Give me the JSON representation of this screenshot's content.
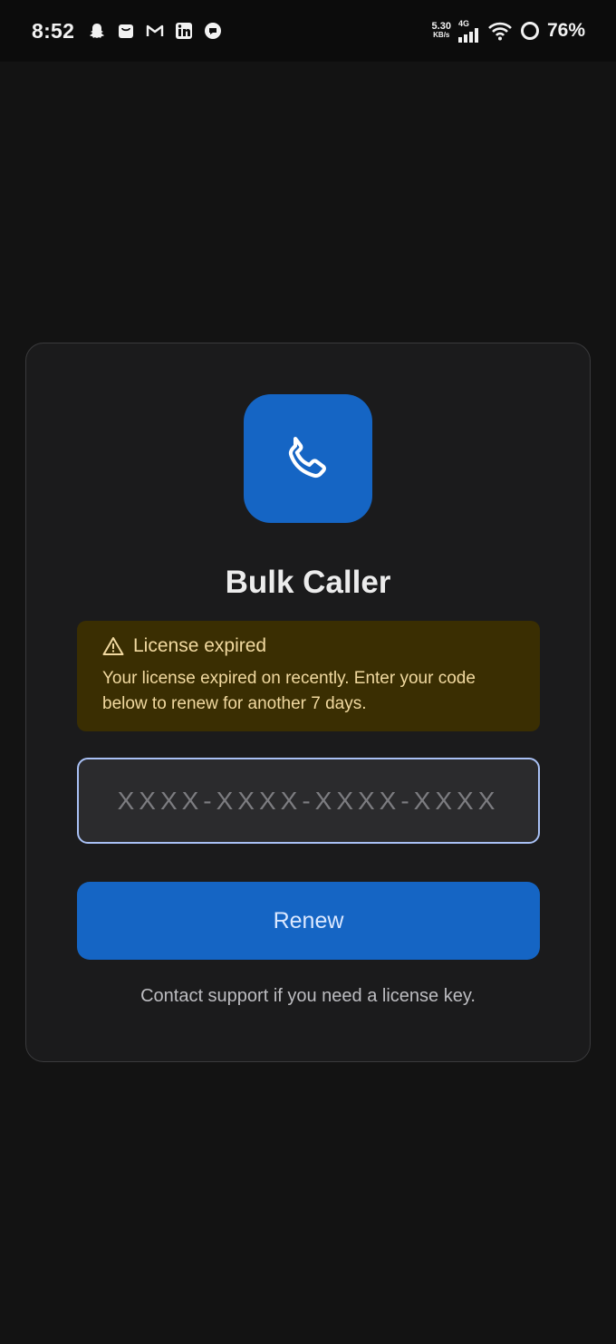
{
  "status_bar": {
    "time": "8:52",
    "notification_icons": [
      "snapchat-icon",
      "shopping-bag-icon",
      "gmail-icon",
      "linkedin-icon",
      "chat-icon"
    ],
    "net_speed_value": "5.30",
    "net_speed_unit": "KB/s",
    "network_type": "4G",
    "battery": "76%"
  },
  "app": {
    "icon": "phone-icon",
    "title": "Bulk Caller",
    "brand_color": "#1565c4"
  },
  "alert": {
    "icon": "warning-icon",
    "title": "License expired",
    "message": "Your license expired on recently. Enter your code below to renew for another 7 days.",
    "color": "#3a2e02"
  },
  "license_form": {
    "placeholder": "XXXX-XXXX-XXXX-XXXX",
    "value": "",
    "submit_label": "Renew",
    "support_text": "Contact support if you need a license key."
  }
}
